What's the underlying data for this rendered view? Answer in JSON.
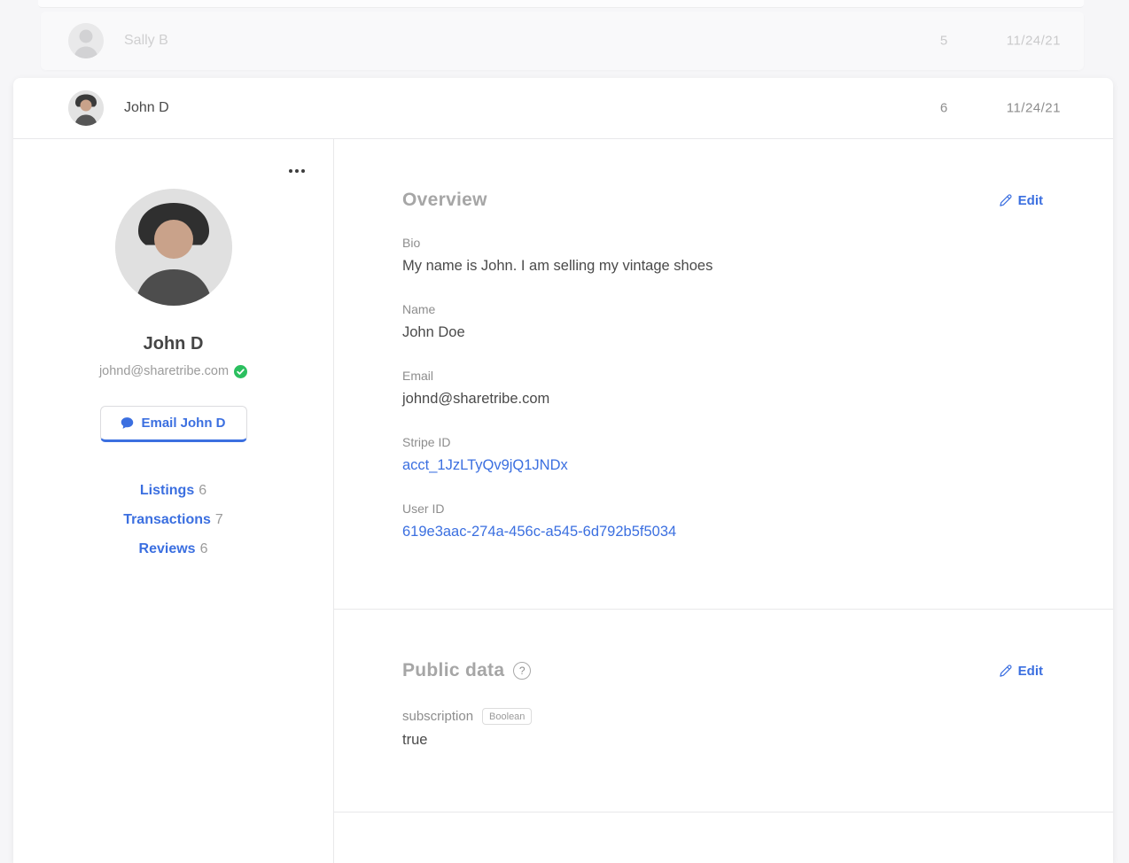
{
  "colors": {
    "accent_blue": "#3b6fe0",
    "verified_green": "#2bbf5f",
    "page_background": "#f6f6f8",
    "heading_gray": "#a6a6a6",
    "text_dark": "#4a4a4a"
  },
  "list": {
    "previous_row": {
      "name": "Sally B",
      "count": "5",
      "date": "11/24/21"
    },
    "expanded_row": {
      "name": "John D",
      "count": "6",
      "date": "11/24/21"
    }
  },
  "profile": {
    "name": "John D",
    "email": "johnd@sharetribe.com",
    "email_button_label": "Email John D",
    "links": [
      {
        "label": "Listings",
        "count": "6"
      },
      {
        "label": "Transactions",
        "count": "7"
      },
      {
        "label": "Reviews",
        "count": "6"
      }
    ]
  },
  "overview": {
    "title": "Overview",
    "edit_label": "Edit",
    "fields": [
      {
        "label": "Bio",
        "value": "My name is John. I am selling my vintage shoes"
      },
      {
        "label": "Name",
        "value": "John Doe"
      },
      {
        "label": "Email",
        "value": "johnd@sharetribe.com"
      },
      {
        "label": "Stripe ID",
        "value": "acct_1JzLTyQv9jQ1JNDx"
      },
      {
        "label": "User ID",
        "value": "619e3aac-274a-456c-a545-6d792b5f5034"
      }
    ]
  },
  "public_data": {
    "title": "Public data",
    "help_icon": "?",
    "edit_label": "Edit",
    "fields": [
      {
        "key": "subscription",
        "type_badge": "Boolean",
        "value": "true"
      }
    ]
  }
}
